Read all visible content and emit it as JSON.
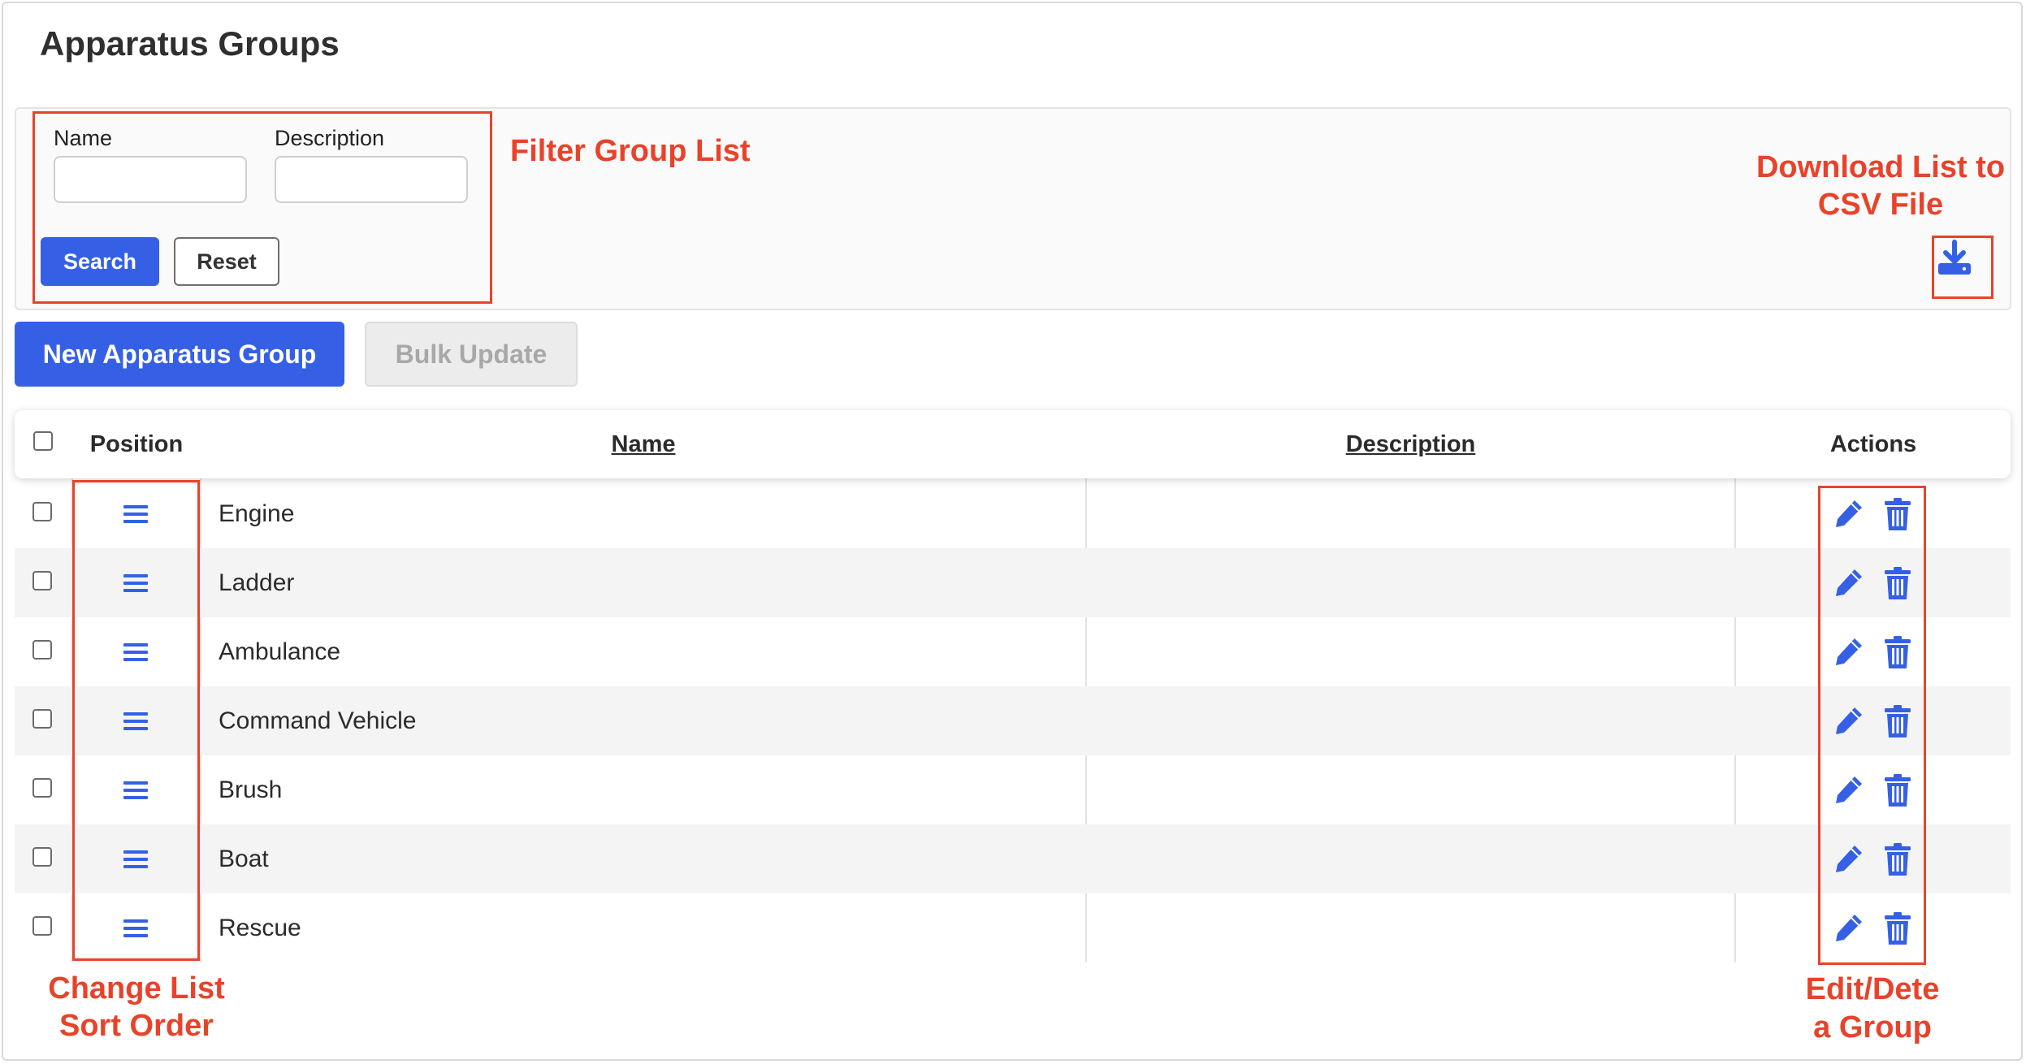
{
  "page": {
    "title": "Apparatus Groups"
  },
  "filter": {
    "name_label": "Name",
    "name_value": "",
    "description_label": "Description",
    "description_value": "",
    "search_label": "Search",
    "reset_label": "Reset"
  },
  "toolbar": {
    "new_label": "New Apparatus Group",
    "bulk_label": "Bulk Update"
  },
  "table": {
    "columns": {
      "position": "Position",
      "name": "Name",
      "description": "Description",
      "actions": "Actions"
    },
    "rows": [
      {
        "name": "Engine",
        "description": ""
      },
      {
        "name": "Ladder",
        "description": ""
      },
      {
        "name": "Ambulance",
        "description": ""
      },
      {
        "name": "Command Vehicle",
        "description": ""
      },
      {
        "name": "Brush",
        "description": ""
      },
      {
        "name": "Boat",
        "description": ""
      },
      {
        "name": "Rescue",
        "description": ""
      }
    ]
  },
  "annotations": {
    "filter": "Filter Group List",
    "download_line1": "Download List to",
    "download_line2": "CSV File",
    "sort_line1": "Change List",
    "sort_line2": "Sort Order",
    "edit_line1": "Edit/Dete",
    "edit_line2": "a Group"
  },
  "icons": {
    "download": "download-icon",
    "drag": "drag-handle-icon",
    "edit": "pencil-icon",
    "delete": "trash-icon"
  },
  "colors": {
    "accent": "#3560e6",
    "annotation": "#e8432a"
  }
}
